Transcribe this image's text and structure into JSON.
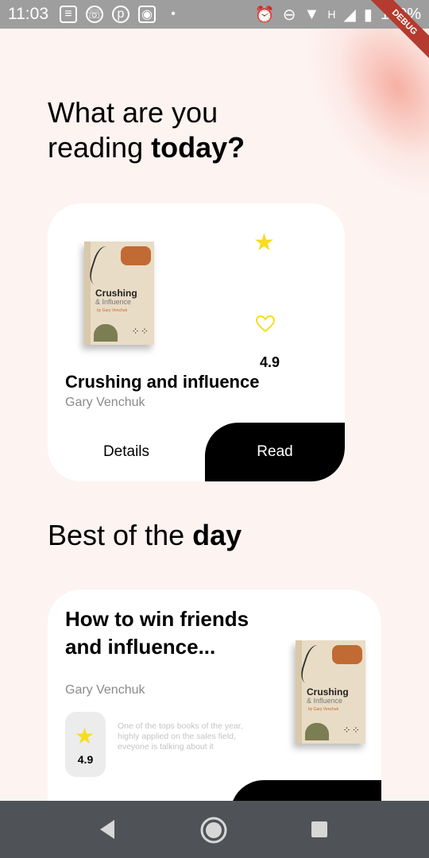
{
  "status_bar": {
    "time": "11:03",
    "battery": "100%",
    "network_letter": "H",
    "debug_label": "DEBUG",
    "left_icons": [
      "news-icon",
      "whatsapp-icon",
      "pinterest-icon",
      "instagram-icon",
      "dot-icon"
    ],
    "right_icons": [
      "alarm-icon",
      "do-not-disturb-icon",
      "wifi-icon",
      "signal-icon",
      "battery-icon"
    ]
  },
  "header": {
    "line1": "What are you",
    "line2_prefix": "reading",
    "line2_bold": "today?"
  },
  "current_book": {
    "cover_title": "Crushing",
    "cover_subtitle": "& Influence",
    "cover_author": "by Gary Venchuk",
    "title": "Crushing and influence",
    "author": "Gary Venchuk",
    "rating": "4.9",
    "details_label": "Details",
    "read_label": "Read"
  },
  "section": {
    "title_prefix": "Best of the",
    "title_bold": "day"
  },
  "best_book": {
    "title": "How to win friends and influence...",
    "author": "Gary Venchuk",
    "rating": "4.9",
    "description": "One of the tops books of the year, highly applied on the sales field, eveyone is talking about it",
    "cover_title": "Crushing",
    "cover_subtitle": "& Influence",
    "cover_author": "by Gary Venchuk"
  },
  "colors": {
    "background": "#fdf3f1",
    "star": "#f7dd1f",
    "button_dark": "#000000",
    "nav_bar": "#4f5358",
    "status_bar": "#9e9e9e"
  }
}
